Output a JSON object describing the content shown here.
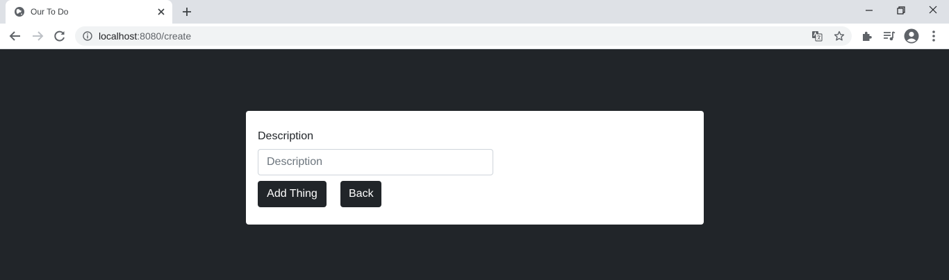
{
  "browser": {
    "tab_title": "Our To Do",
    "url_host": "localhost",
    "url_rest": ":8080/create"
  },
  "form": {
    "label": "Description",
    "input_placeholder": "Description",
    "input_value": "",
    "add_button": "Add Thing",
    "back_button": "Back"
  },
  "colors": {
    "page_background": "#212529",
    "card_background": "#ffffff",
    "button_background": "#212529"
  }
}
